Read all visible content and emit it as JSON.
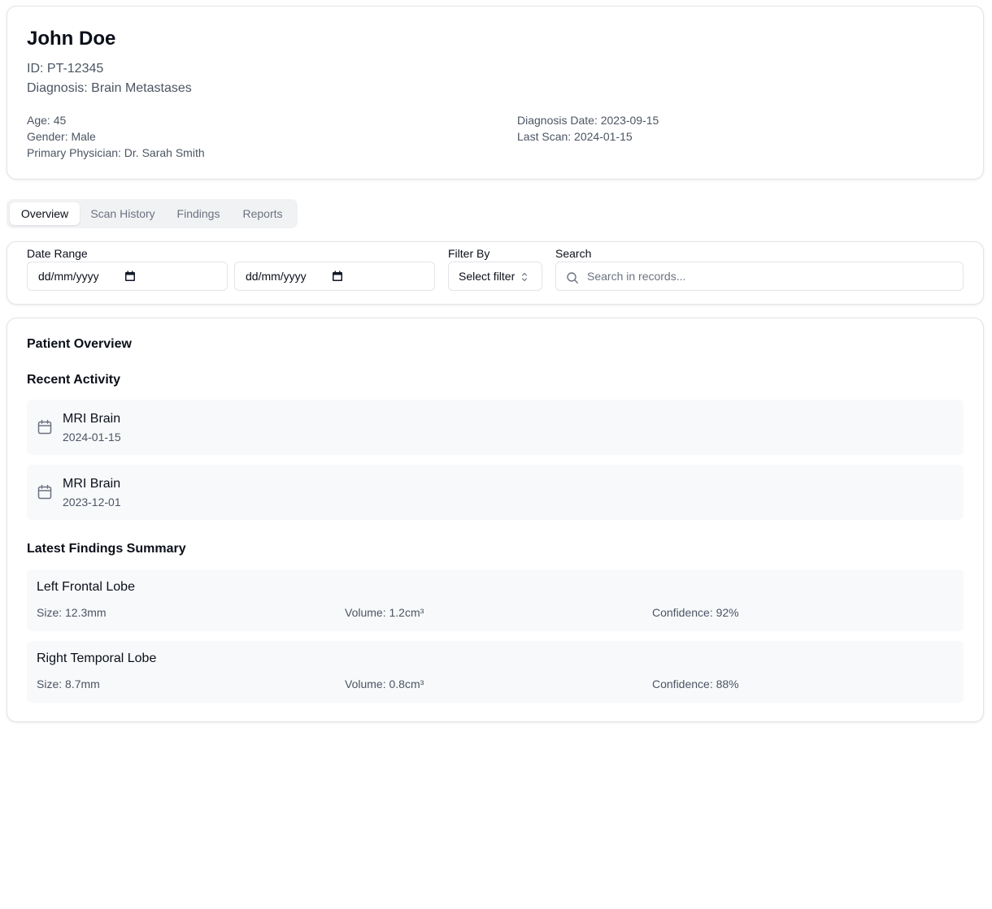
{
  "patient": {
    "name": "John Doe",
    "id_line": "ID: PT-12345",
    "diagnosis_line": "Diagnosis: Brain Metastases",
    "age": "Age: 45",
    "gender": "Gender: Male",
    "physician": "Primary Physician: Dr. Sarah Smith",
    "diagnosis_date": "Diagnosis Date: 2023-09-15",
    "last_scan": "Last Scan: 2024-01-15"
  },
  "tabs": [
    {
      "label": "Overview",
      "active": true
    },
    {
      "label": "Scan History",
      "active": false
    },
    {
      "label": "Findings",
      "active": false
    },
    {
      "label": "Reports",
      "active": false
    }
  ],
  "filters": {
    "date_range_label": "Date Range",
    "date_start": "dd/mm/yyyy",
    "date_end": "dd/mm/yyyy",
    "filter_by_label": "Filter By",
    "filter_select_value": "Select filter",
    "search_label": "Search",
    "search_placeholder": "Search in records..."
  },
  "overview": {
    "title": "Patient Overview",
    "recent_activity_title": "Recent Activity",
    "activities": [
      {
        "title": "MRI Brain",
        "date": "2024-01-15",
        "icon": "calendar-icon"
      },
      {
        "title": "MRI Brain",
        "date": "2023-12-01",
        "icon": "calendar-icon"
      }
    ],
    "findings_title": "Latest Findings Summary",
    "findings": [
      {
        "location": "Left Frontal Lobe",
        "size": "Size: 12.3mm",
        "volume": "Volume: 1.2cm³",
        "confidence": "Confidence: 92%"
      },
      {
        "location": "Right Temporal Lobe",
        "size": "Size: 8.7mm",
        "volume": "Volume: 0.8cm³",
        "confidence": "Confidence: 88%"
      }
    ]
  },
  "colors": {
    "text_primary": "#0b0f19",
    "text_muted": "#4b5563",
    "tab_inactive": "#6b7280",
    "card_border": "#e2e4e8",
    "item_background": "#f8f9fb",
    "tab_bar_background": "#f1f2f4"
  }
}
